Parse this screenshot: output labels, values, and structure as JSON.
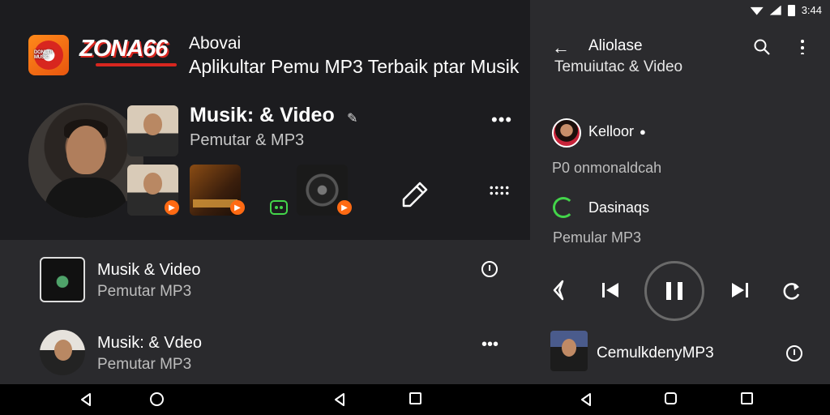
{
  "status_bar": {
    "time": "3:44"
  },
  "left": {
    "app_logo_text": "DONLTR MUSIC",
    "brand": "ZONA66",
    "title_small": "Abovai",
    "title_big": "Aplikultar Pemu MP3 Terbaik ptar Musik",
    "featured": {
      "title": "Musik: & Video",
      "subtitle": "Pemutar & MP3"
    },
    "list": [
      {
        "title": "Musik & Video",
        "subtitle": "Pemutar MP3"
      },
      {
        "title": "Musik: & Vdeo",
        "subtitle": "Pemutar MP3"
      }
    ]
  },
  "right": {
    "header_title": "Aliolase",
    "header_subtitle": "Temuiutac & Video",
    "artist_name": "Kelloor",
    "stats": "P0 onmonaldcah",
    "section_title": "Dasinaqs",
    "section_sub": "Pemular MP3",
    "now_playing_title": "CemulkdenyMP3"
  },
  "colors": {
    "accent_orange": "#ff6a13",
    "accent_green": "#43d54a",
    "brand_red": "#d8261f"
  }
}
